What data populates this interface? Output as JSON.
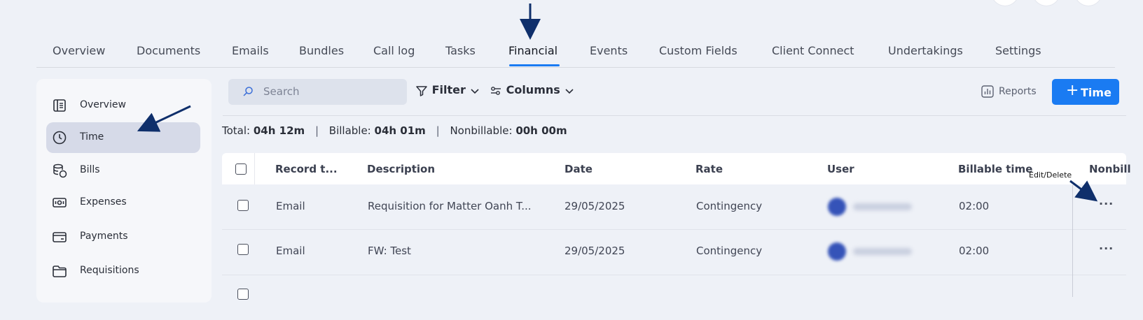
{
  "tabs": [
    "Overview",
    "Documents",
    "Emails",
    "Bundles",
    "Call log",
    "Tasks",
    "Financial",
    "Events",
    "Custom Fields",
    "Client Connect",
    "Undertakings",
    "Settings"
  ],
  "active_tab": "Financial",
  "sidebar": {
    "items": [
      {
        "label": "Overview",
        "icon": "book-icon"
      },
      {
        "label": "Time",
        "icon": "clock-icon"
      },
      {
        "label": "Bills",
        "icon": "coins-icon"
      },
      {
        "label": "Expenses",
        "icon": "banknote-icon"
      },
      {
        "label": "Payments",
        "icon": "card-icon"
      },
      {
        "label": "Requisitions",
        "icon": "folder-icon"
      }
    ],
    "active": "Time"
  },
  "toolbar": {
    "search_placeholder": "Search",
    "filter_label": "Filter",
    "columns_label": "Columns",
    "reports_label": "Reports",
    "add_time_label": "Time"
  },
  "totals": {
    "total_label": "Total:",
    "total_value": "04h 12m",
    "billable_label": "Billable:",
    "billable_value": "04h 01m",
    "nonbillable_label": "Nonbillable:",
    "nonbillable_value": "00h 00m",
    "separator": "|"
  },
  "table": {
    "columns": [
      "Record t...",
      "Description",
      "Date",
      "Rate",
      "User",
      "Billable time",
      "Nonbill"
    ],
    "rows": [
      {
        "record_type": "Email",
        "description": "Requisition for Matter Oanh T...",
        "date": "29/05/2025",
        "rate": "Contingency",
        "billable_time": "02:00"
      },
      {
        "record_type": "Email",
        "description": "FW: Test",
        "date": "29/05/2025",
        "rate": "Contingency",
        "billable_time": "02:00"
      }
    ]
  },
  "annotation": {
    "edit_delete_label": "Edit/Delete",
    "arrow_color": "#0f2f6b"
  },
  "colors": {
    "accent": "#1a7bf2",
    "sidebar_active": "#d6dae8",
    "background": "#eef1f7"
  }
}
